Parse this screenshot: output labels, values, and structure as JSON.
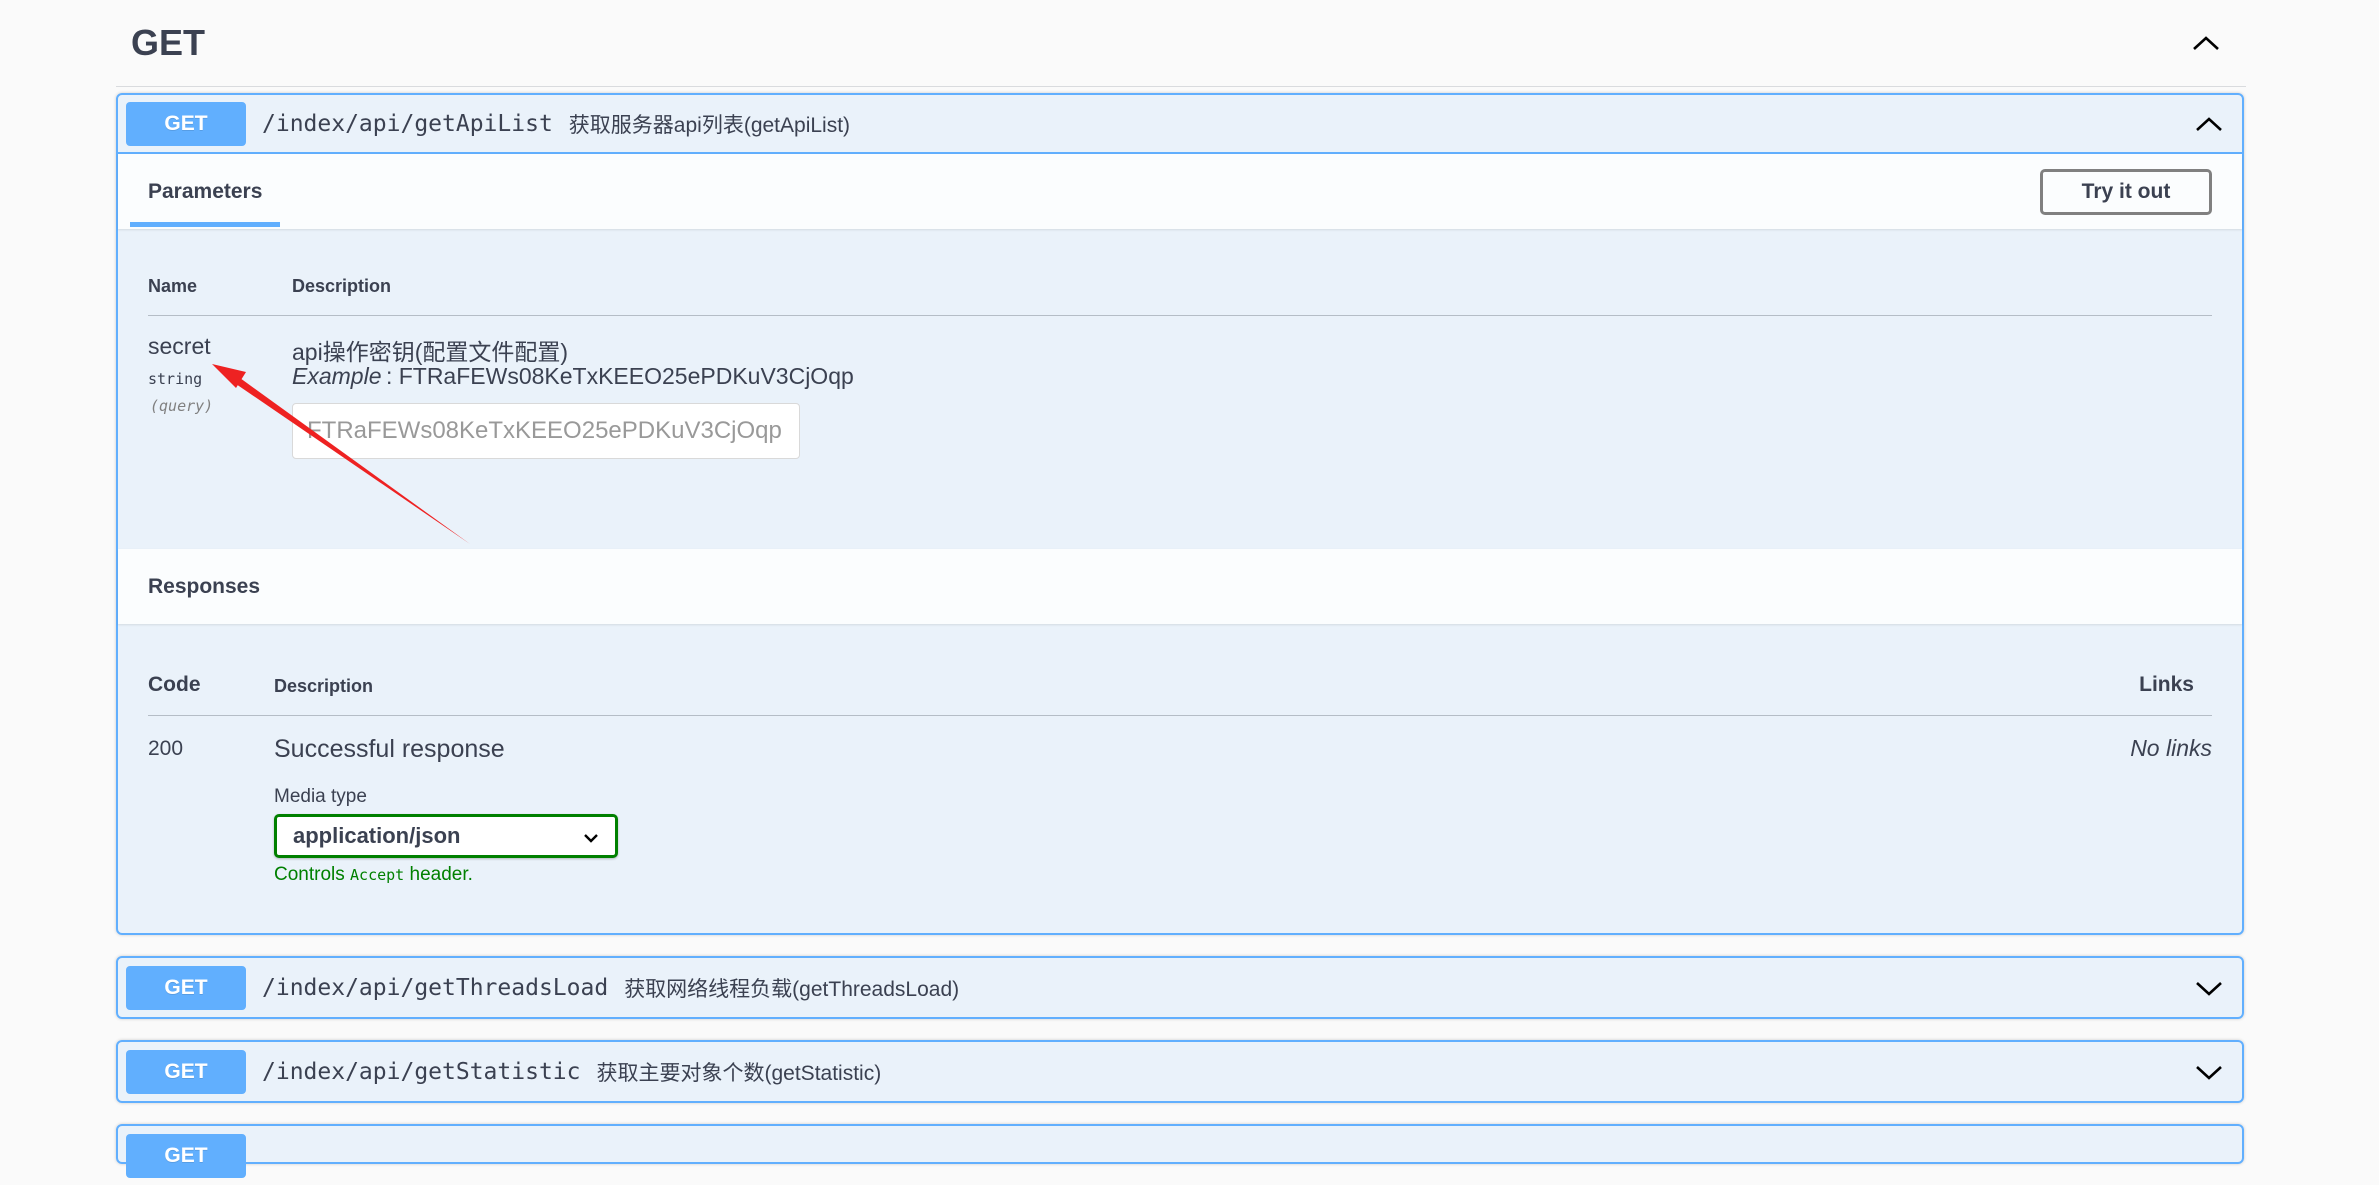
{
  "tag": {
    "title": "GET"
  },
  "operations": [
    {
      "method": "GET",
      "path": "/index/api/getApiList",
      "summary": "获取服务器api列表(getApiList)",
      "parameters_tab": "Parameters",
      "try_button": "Try it out",
      "param_columns": {
        "name": "Name",
        "description": "Description"
      },
      "params": [
        {
          "name": "secret",
          "type": "string",
          "in": "(query)",
          "description": "api操作密钥(配置文件配置)",
          "example_label": "Example",
          "example_value": ": FTRaFEWs08KeTxKEEO25ePDKuV3CjOqp",
          "placeholder": "FTRaFEWs08KeTxKEEO25ePDKuV3CjOqp"
        }
      ],
      "responses_title": "Responses",
      "resp_columns": {
        "code": "Code",
        "description": "Description",
        "links": "Links"
      },
      "responses": [
        {
          "code": "200",
          "description": "Successful response",
          "links": "No links",
          "media_type_label": "Media type",
          "media_type": "application/json",
          "controls_prefix": "Controls",
          "controls_code": "Accept",
          "controls_suffix": "header."
        }
      ]
    },
    {
      "method": "GET",
      "path": "/index/api/getThreadsLoad",
      "summary": "获取网络线程负载(getThreadsLoad)"
    },
    {
      "method": "GET",
      "path": "/index/api/getStatistic",
      "summary": "获取主要对象个数(getStatistic)"
    },
    {
      "method": "GET"
    }
  ],
  "colors": {
    "get": "#61affe",
    "annotation_arrow": "#ee2222",
    "media_ok": "#008000"
  }
}
